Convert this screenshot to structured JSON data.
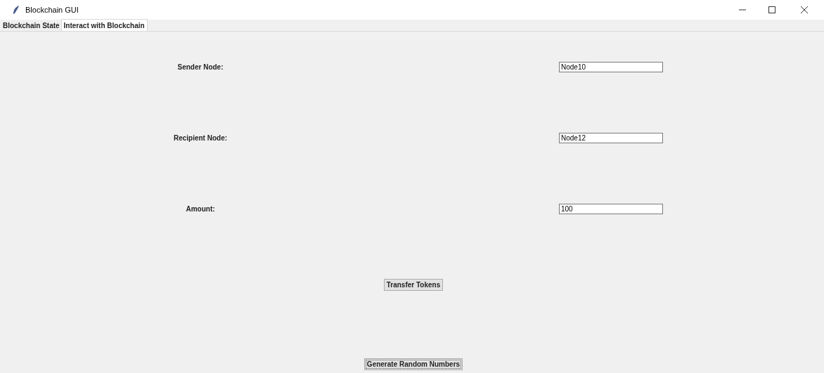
{
  "window": {
    "title": "Blockchain GUI"
  },
  "tabs": [
    {
      "label": "Blockchain State",
      "selected": false
    },
    {
      "label": "Interact with Blockchain",
      "selected": true
    }
  ],
  "form": [
    {
      "label": "Sender Node:",
      "value": "Node10"
    },
    {
      "label": "Recipient Node:",
      "value": "Node12"
    },
    {
      "label": "Amount:",
      "value": "100"
    }
  ],
  "buttons": [
    {
      "label": "Transfer Tokens",
      "focused": false
    },
    {
      "label": "Generate Random Numbers",
      "focused": true
    }
  ]
}
